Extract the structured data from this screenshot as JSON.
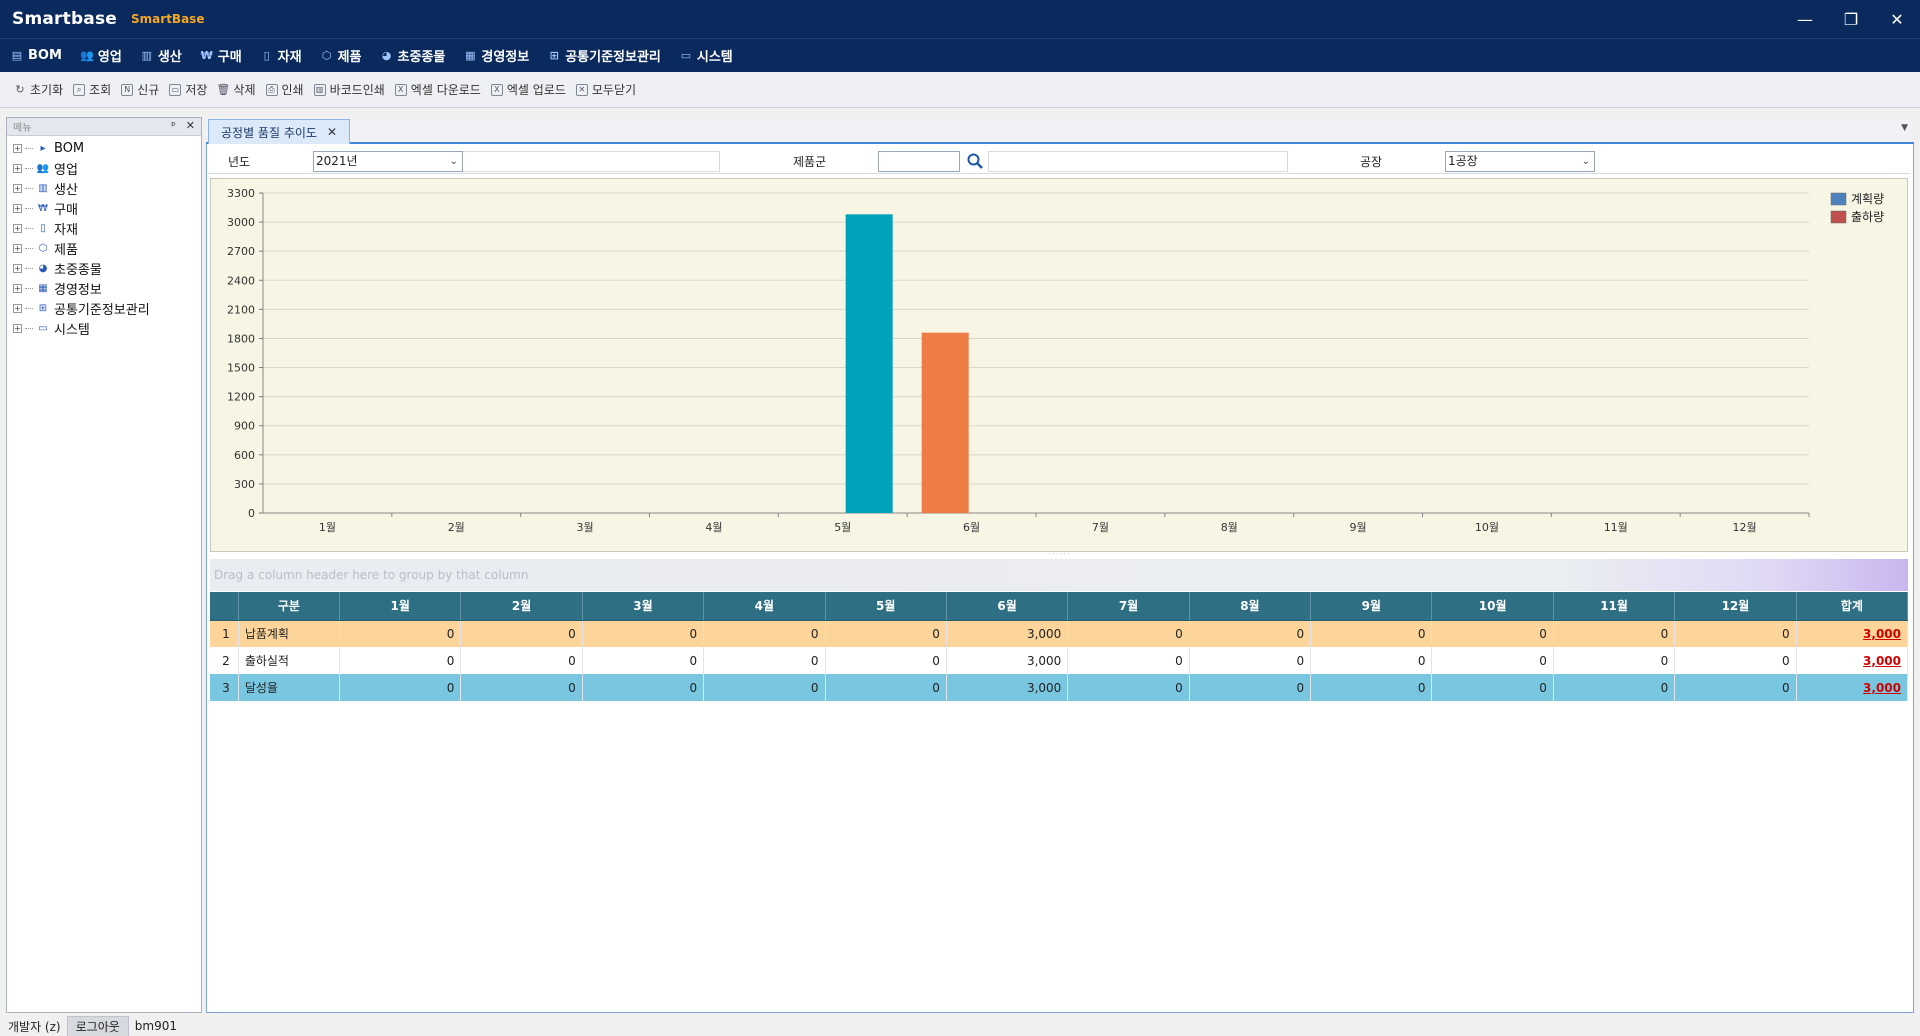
{
  "app": {
    "logo": "Smartbase",
    "name": "SmartBase"
  },
  "window_controls": {
    "minimize": "—",
    "restore": "❐",
    "close": "✕"
  },
  "main_menu": [
    {
      "label": "BOM",
      "icon": "bom-icon"
    },
    {
      "label": "영업",
      "icon": "people-icon"
    },
    {
      "label": "생산",
      "icon": "chart-icon"
    },
    {
      "label": "구매",
      "icon": "won-icon"
    },
    {
      "label": "자재",
      "icon": "doc-icon"
    },
    {
      "label": "제품",
      "icon": "box-icon"
    },
    {
      "label": "초중종물",
      "icon": "pie-icon"
    },
    {
      "label": "경영정보",
      "icon": "calendar-icon"
    },
    {
      "label": "공통기준정보관리",
      "icon": "org-icon"
    },
    {
      "label": "시스템",
      "icon": "monitor-icon"
    }
  ],
  "toolbar": [
    {
      "label": "초기화",
      "icon": "refresh-icon"
    },
    {
      "label": "조회",
      "icon": "search-icon"
    },
    {
      "label": "신규",
      "icon": "new-icon"
    },
    {
      "label": "저장",
      "icon": "save-icon"
    },
    {
      "label": "삭제",
      "icon": "trash-icon"
    },
    {
      "label": "인쇄",
      "icon": "print-icon"
    },
    {
      "label": "바코드인쇄",
      "icon": "barcode-icon"
    },
    {
      "label": "엑셀 다운로드",
      "icon": "excel-download-icon"
    },
    {
      "label": "엑셀 업로드",
      "icon": "excel-upload-icon"
    },
    {
      "label": "모두닫기",
      "icon": "close-all-icon"
    }
  ],
  "left_panel": {
    "header": "메뉴",
    "pin": "ᵖ",
    "close": "✕",
    "tree": [
      "BOM",
      "영업",
      "생산",
      "구매",
      "자재",
      "제품",
      "초중종물",
      "경영정보",
      "공통기준정보관리",
      "시스템"
    ]
  },
  "tab": {
    "label": "공정별 품질 추이도",
    "close": "✕",
    "menu": "▼"
  },
  "filters": {
    "year_label": "년도",
    "year_value": "2021년",
    "product_group_label": "제품군",
    "product_group_value": "",
    "factory_label": "공장",
    "factory_value": "1공장"
  },
  "chart_data": {
    "type": "bar",
    "categories": [
      "1월",
      "2월",
      "3월",
      "4월",
      "5월",
      "6월",
      "7월",
      "8월",
      "9월",
      "10월",
      "11월",
      "12월"
    ],
    "series": [
      {
        "name": "계획량",
        "legend_color": "#4f81bd",
        "bar_color": "#00a3bb",
        "values": [
          0,
          0,
          0,
          0,
          3080,
          0,
          0,
          0,
          0,
          0,
          0,
          0
        ]
      },
      {
        "name": "출하량",
        "legend_color": "#c0504d",
        "bar_color": "#ed7d44",
        "values": [
          0,
          0,
          0,
          0,
          1860,
          0,
          0,
          0,
          0,
          0,
          0,
          0
        ]
      }
    ],
    "yticks": [
      0,
      300,
      600,
      900,
      1200,
      1500,
      1800,
      2100,
      2400,
      2700,
      3000,
      3300
    ],
    "ylim": [
      0,
      3300
    ],
    "grid": true,
    "legend": "top-right"
  },
  "group_panel_hint": "Drag a column header here to group by that column",
  "grid": {
    "headers": [
      "",
      "구분",
      "1월",
      "2월",
      "3월",
      "4월",
      "5월",
      "6월",
      "7월",
      "8월",
      "9월",
      "10월",
      "11월",
      "12월",
      "합계"
    ],
    "rows": [
      {
        "idx": "1",
        "name": "납품계획",
        "cells": [
          "0",
          "0",
          "0",
          "0",
          "0",
          "3,000",
          "0",
          "0",
          "0",
          "0",
          "0",
          "0"
        ],
        "total": "3,000"
      },
      {
        "idx": "2",
        "name": "출하실적",
        "cells": [
          "0",
          "0",
          "0",
          "0",
          "0",
          "3,000",
          "0",
          "0",
          "0",
          "0",
          "0",
          "0"
        ],
        "total": "3,000"
      },
      {
        "idx": "3",
        "name": "달성율",
        "cells": [
          "0",
          "0",
          "0",
          "0",
          "0",
          "3,000",
          "0",
          "0",
          "0",
          "0",
          "0",
          "0"
        ],
        "total": "3,000"
      }
    ]
  },
  "status": {
    "user": "개발자 (z)",
    "logout": "로그아웃",
    "code": "bm901"
  }
}
